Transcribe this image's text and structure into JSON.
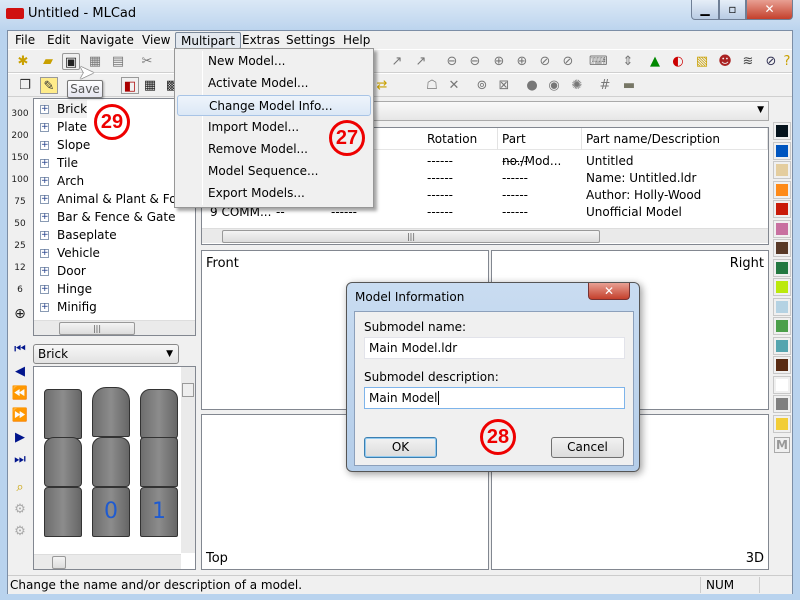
{
  "window": {
    "title": "Untitled - MLCad",
    "minimize": "▁",
    "maximize": "▫",
    "close": "✕"
  },
  "menubar": [
    "File",
    "Edit",
    "Navigate",
    "View",
    "Multipart",
    "Extras",
    "Settings",
    "Help"
  ],
  "multipart_menu": {
    "items": [
      "New Model...",
      "Activate Model...",
      "Change Model Info...",
      "Import Model...",
      "Remove Model...",
      "Model Sequence...",
      "Export Models..."
    ],
    "highlighted": "Change Model Info..."
  },
  "tooltip": "Save",
  "zoom_levels": [
    "300",
    "200",
    "150",
    "100",
    "75",
    "50",
    "25",
    "12",
    "6"
  ],
  "parts_tree": [
    "Brick",
    "Plate",
    "Slope",
    "Tile",
    "Arch",
    "Animal & Plant & Food",
    "Bar & Fence & Gate",
    "Baseplate",
    "Vehicle",
    "Door",
    "Hinge",
    "Minifig"
  ],
  "parts_category": "Brick",
  "table": {
    "headers": [
      "Rotation",
      "Part no./Mod...",
      "Part name/Description"
    ],
    "rows": [
      {
        "type": "",
        "color": "",
        "pos": "",
        "rotation": "------",
        "partno": "------",
        "desc": "Untitled"
      },
      {
        "type": "",
        "color": "",
        "pos": "",
        "rotation": "------",
        "partno": "------",
        "desc": "Name: Untitled.ldr"
      },
      {
        "type": "",
        "color": "",
        "pos": "",
        "rotation": "------",
        "partno": "------",
        "desc": "Author: Holly-Wood"
      },
      {
        "type": "9 COMM...",
        "color": "--",
        "pos": "------",
        "rotation": "------",
        "partno": "------",
        "desc": "Unofficial Model"
      }
    ]
  },
  "viewports": {
    "front": "Front",
    "right": "Right",
    "top": "Top",
    "3d": "3D"
  },
  "colors": [
    "#05131d",
    "#0055bf",
    "#e4cd9e",
    "#fe8a18",
    "#c91a09",
    "#c870a0",
    "#583927",
    "#237841",
    "#bbe90b",
    "#b4d2e3",
    "#4b9f4a",
    "#55a5af",
    "#582a12",
    "#ffffff",
    "#808080",
    "#f2cd37"
  ],
  "colors_more": "M",
  "dialog": {
    "title": "Model Information",
    "name_label": "Submodel name:",
    "name_value": "Main Model.ldr",
    "desc_label": "Submodel description:",
    "desc_value": "Main Model",
    "ok": "OK",
    "cancel": "Cancel",
    "close": "✕"
  },
  "annotations": [
    "29",
    "27",
    "28"
  ],
  "statusbar": {
    "text": "Change the name and/or description of a model.",
    "num": "NUM"
  }
}
